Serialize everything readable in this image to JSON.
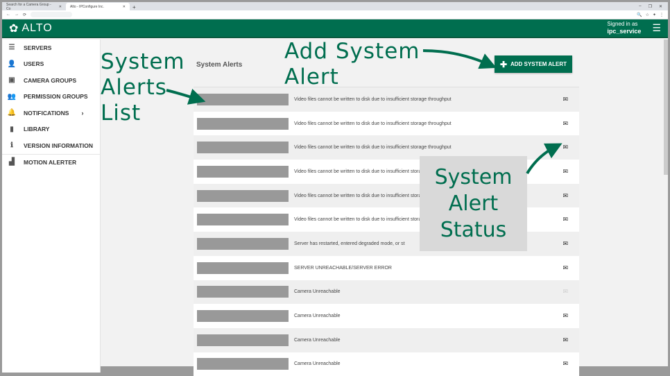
{
  "browser": {
    "tabs": [
      "Search for a Camera Group - Co",
      "Alto - IPConfigure Inc."
    ],
    "new_tab": "+"
  },
  "header": {
    "logo": "ALTO",
    "signed_in_label": "Signed in as",
    "user": "ipc_service"
  },
  "sidebar": {
    "items": [
      {
        "label": "SERVERS",
        "icon": "server-icon",
        "glyph": "☰"
      },
      {
        "label": "USERS",
        "icon": "user-icon",
        "glyph": "👤"
      },
      {
        "label": "CAMERA GROUPS",
        "icon": "camera-group-icon",
        "glyph": "▣"
      },
      {
        "label": "PERMISSION GROUPS",
        "icon": "group-icon",
        "glyph": "👥"
      },
      {
        "label": "NOTIFICATIONS",
        "icon": "bell-icon",
        "glyph": "🔔"
      },
      {
        "label": "LIBRARY",
        "icon": "bookmark-icon",
        "glyph": "▮"
      },
      {
        "label": "VERSION INFORMATION",
        "icon": "info-icon",
        "glyph": "ℹ"
      },
      {
        "label": "MOTION ALERTER",
        "icon": "motion-icon",
        "glyph": "▟"
      }
    ]
  },
  "main": {
    "title": "System Alerts",
    "add_button": "ADD SYSTEM ALERT",
    "alerts": [
      {
        "text": "Video files cannot be written to disk due to insufficient storage throughput",
        "enabled": true
      },
      {
        "text": "Video files cannot be written to disk due to insufficient storage throughput",
        "enabled": true
      },
      {
        "text": "Video files cannot be written to disk due to insufficient storage throughput",
        "enabled": true
      },
      {
        "text": "Video files cannot be written to disk due to insufficient storage throughput",
        "enabled": true
      },
      {
        "text": "Video files cannot be written to disk due to insufficient storage throughput",
        "enabled": true
      },
      {
        "text": "Video files cannot be written to disk due to insufficient storage throughput",
        "enabled": true
      },
      {
        "text": "Server has restarted, entered degraded mode, or st",
        "enabled": true
      },
      {
        "text": "SERVER UNREACHABLE/SERVER ERROR",
        "enabled": true
      },
      {
        "text": "Camera Unreachable",
        "enabled": false
      },
      {
        "text": "Camera Unreachable",
        "enabled": true
      },
      {
        "text": "Camera Unreachable",
        "enabled": true
      },
      {
        "text": "Camera Unreachable",
        "enabled": true
      }
    ]
  },
  "annotations": {
    "list": [
      "System",
      "Alerts",
      "List"
    ],
    "add": [
      "Add System",
      "Alert"
    ],
    "status": [
      "System",
      "Alert",
      "Status"
    ]
  },
  "colors": {
    "brand": "#006e4f"
  }
}
